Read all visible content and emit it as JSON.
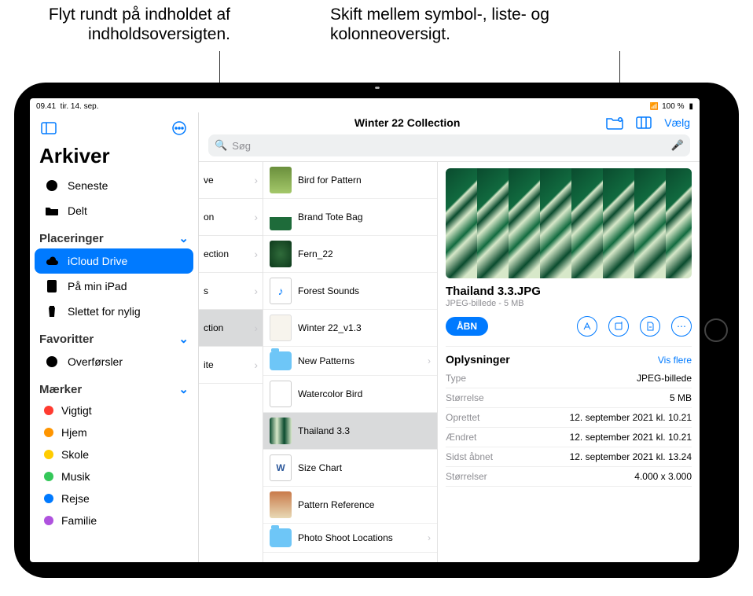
{
  "callouts": {
    "left": "Flyt rundt på indholdet af indholdsoversigten.",
    "right": "Skift mellem symbol-, liste- og kolonneoversigt."
  },
  "status": {
    "time": "09.41",
    "date": "tir. 14. sep.",
    "battery": "100 %"
  },
  "sidebar": {
    "title": "Arkiver",
    "recent": "Seneste",
    "shared": "Delt",
    "sections": {
      "locations": "Placeringer",
      "favorites": "Favoritter",
      "tags": "Mærker"
    },
    "locations": {
      "icloud": "iCloud Drive",
      "onipad": "På min iPad",
      "trash": "Slettet for nylig"
    },
    "favorites": {
      "downloads": "Overførsler"
    },
    "tags": [
      {
        "label": "Vigtigt",
        "color": "#ff3b30"
      },
      {
        "label": "Hjem",
        "color": "#ff9500"
      },
      {
        "label": "Skole",
        "color": "#ffcc00"
      },
      {
        "label": "Musik",
        "color": "#34c759"
      },
      {
        "label": "Rejse",
        "color": "#007aff"
      },
      {
        "label": "Familie",
        "color": "#af52de"
      }
    ]
  },
  "toolbar": {
    "title": "Winter 22 Collection",
    "select": "Vælg"
  },
  "search": {
    "placeholder": "Søg"
  },
  "col1": [
    "ve",
    "on",
    "ection",
    "s",
    "ction",
    "ite"
  ],
  "files": [
    {
      "name": "Bird for Pattern",
      "cls": "th-bird"
    },
    {
      "name": "Brand Tote Bag",
      "cls": "th-bag"
    },
    {
      "name": "Fern_22",
      "cls": "th-fern"
    },
    {
      "name": "Forest Sounds",
      "cls": "th-sound"
    },
    {
      "name": "Winter 22_v1.3",
      "cls": "th-doc"
    },
    {
      "name": "New Patterns",
      "cls": "folder",
      "folder": true
    },
    {
      "name": "Watercolor Bird",
      "cls": "th-water"
    },
    {
      "name": "Thailand 3.3",
      "cls": "th-thai",
      "selected": true
    },
    {
      "name": "Size Chart",
      "cls": "th-w"
    },
    {
      "name": "Pattern Reference",
      "cls": "th-pat"
    },
    {
      "name": "Photo Shoot Locations",
      "cls": "folder",
      "folder": true
    }
  ],
  "detail": {
    "name": "Thailand 3.3.JPG",
    "subtitle": "JPEG-billede - 5 MB",
    "open": "ÅBN",
    "info_title": "Oplysninger",
    "show_more": "Vis flere",
    "rows": [
      {
        "k": "Type",
        "v": "JPEG-billede"
      },
      {
        "k": "Størrelse",
        "v": "5 MB"
      },
      {
        "k": "Oprettet",
        "v": "12. september 2021 kl. 10.21"
      },
      {
        "k": "Ændret",
        "v": "12. september 2021 kl. 10.21"
      },
      {
        "k": "Sidst åbnet",
        "v": "12. september 2021 kl. 13.24"
      },
      {
        "k": "Størrelser",
        "v": "4.000 x 3.000"
      }
    ]
  }
}
